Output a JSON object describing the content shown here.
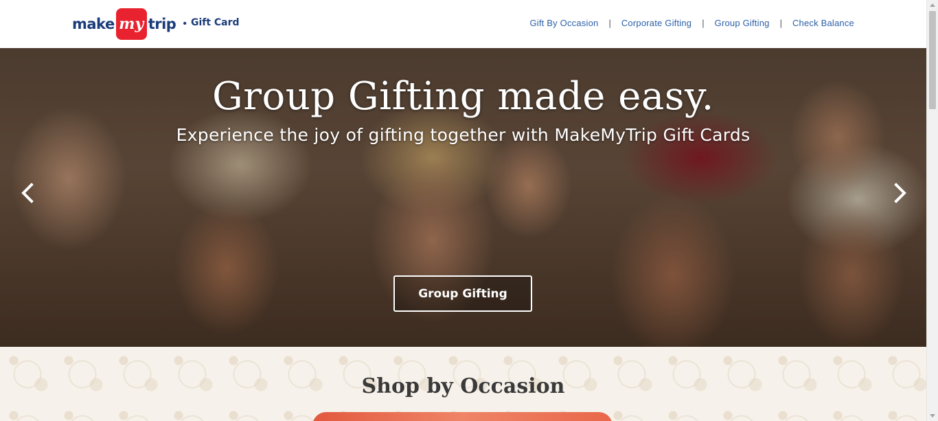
{
  "header": {
    "logo": {
      "make": "make",
      "my": "my",
      "trip": "trip",
      "product": "Gift Card"
    },
    "nav": [
      {
        "label": "Gift By Occasion"
      },
      {
        "label": "Corporate Gifting"
      },
      {
        "label": "Group Gifting"
      },
      {
        "label": "Check Balance"
      }
    ],
    "separator": "|"
  },
  "hero": {
    "title": "Group Gifting made easy.",
    "subtitle": "Experience the joy of gifting together with MakeMyTrip Gift Cards",
    "cta_label": "Group Gifting",
    "prev_icon": "chevron-left-icon",
    "next_icon": "chevron-right-icon"
  },
  "occasion": {
    "title": "Shop by Occasion"
  },
  "colors": {
    "brand_blue": "#1b3c7a",
    "brand_red": "#e8222f",
    "nav_link": "#2b5fa8"
  }
}
